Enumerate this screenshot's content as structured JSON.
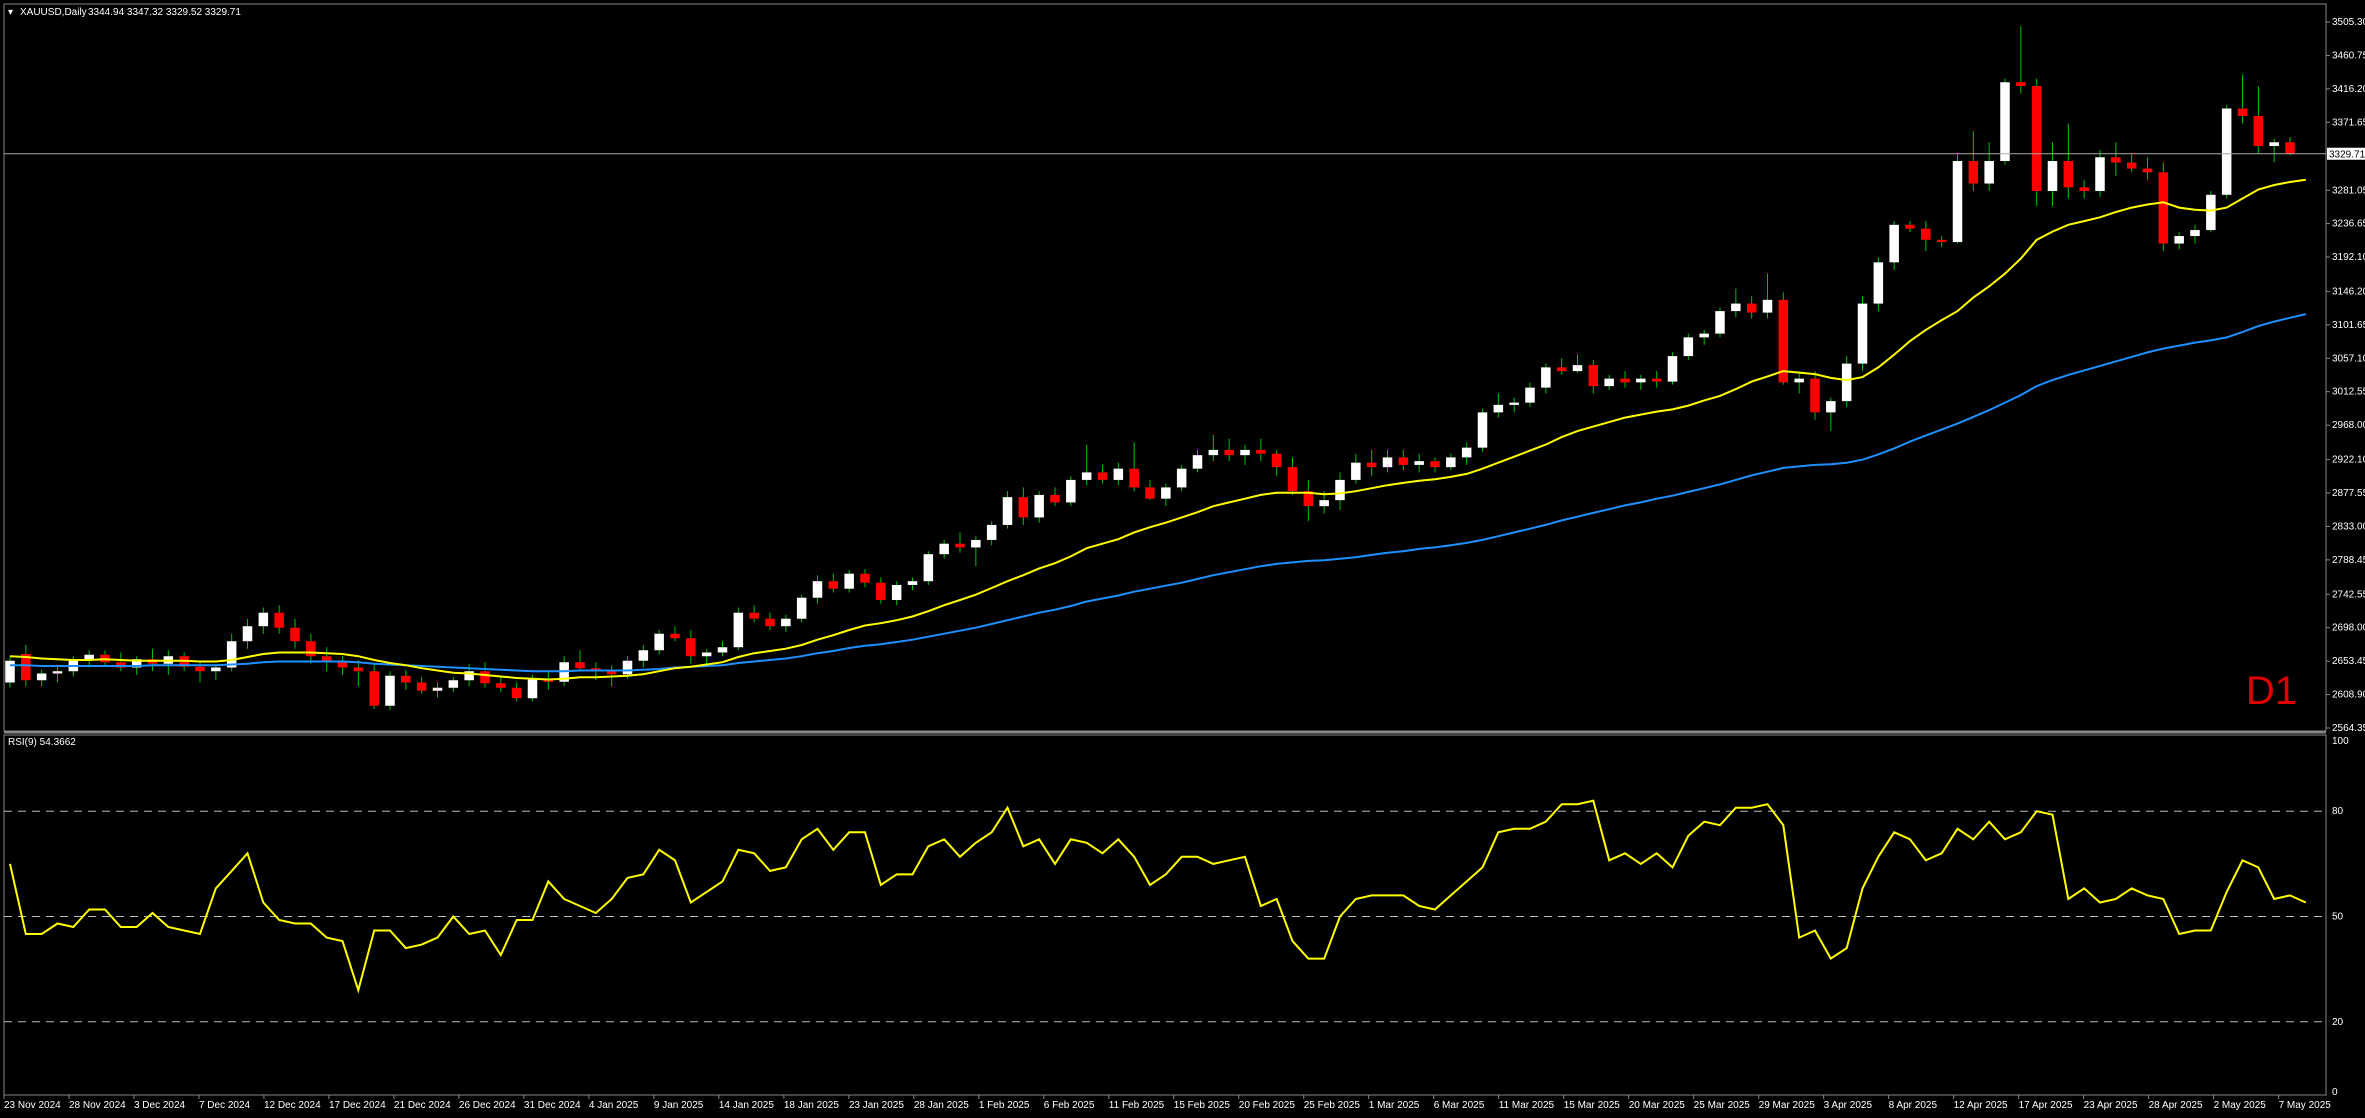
{
  "header": {
    "symbol": "XAUUSD,Daily",
    "ohlc": "3344.94 3347.32 3329.52 3329.71"
  },
  "timeframe_label": "D1",
  "price_axis": {
    "ticks": [
      "3505.30",
      "3460.75",
      "3416.20",
      "3371.65",
      "3281.05",
      "3236.65",
      "3192.10",
      "3146.20",
      "3101.65",
      "3057.10",
      "3012.55",
      "2968.00",
      "2922.10",
      "2877.55",
      "2833.00",
      "2788.45",
      "2742.55",
      "2698.00",
      "2653.45",
      "2608.90",
      "2564.35"
    ],
    "current_price": "3329.71",
    "ylim": [
      2564.35,
      3505.3
    ]
  },
  "rsi": {
    "label": "RSI(9) 54.3662",
    "levels": [
      80,
      50,
      20
    ],
    "ticks": [
      "100",
      "80",
      "50",
      "20",
      "0"
    ]
  },
  "date_labels": [
    "23 Nov 2024",
    "28 Nov 2024",
    "3 Dec 2024",
    "7 Dec 2024",
    "12 Dec 2024",
    "17 Dec 2024",
    "21 Dec 2024",
    "26 Dec 2024",
    "31 Dec 2024",
    "4 Jan 2025",
    "9 Jan 2025",
    "14 Jan 2025",
    "18 Jan 2025",
    "23 Jan 2025",
    "28 Jan 2025",
    "1 Feb 2025",
    "6 Feb 2025",
    "11 Feb 2025",
    "15 Feb 2025",
    "20 Feb 2025",
    "25 Feb 2025",
    "1 Mar 2025",
    "6 Mar 2025",
    "11 Mar 2025",
    "15 Mar 2025",
    "20 Mar 2025",
    "25 Mar 2025",
    "29 Mar 2025",
    "3 Apr 2025",
    "8 Apr 2025",
    "12 Apr 2025",
    "17 Apr 2025",
    "23 Apr 2025",
    "28 Apr 2025",
    "2 May 2025",
    "7 May 2025"
  ],
  "colors": {
    "bull": "#ffffff",
    "bear": "#ff0000",
    "wick": "#00c000",
    "ma_fast": "#ffff00",
    "ma_slow": "#1e90ff",
    "rsi_line": "#ffff00",
    "grid": "#bbbbbb"
  },
  "chart_data": {
    "type": "candlestick",
    "ylim": [
      2564.35,
      3505.3
    ],
    "candles": [
      [
        2625,
        2660,
        2618,
        2654
      ],
      [
        2663,
        2675,
        2620,
        2628
      ],
      [
        2628,
        2642,
        2620,
        2637
      ],
      [
        2637,
        2648,
        2625,
        2640
      ],
      [
        2640,
        2660,
        2633,
        2656
      ],
      [
        2656,
        2668,
        2645,
        2662
      ],
      [
        2662,
        2668,
        2648,
        2652
      ],
      [
        2652,
        2665,
        2640,
        2645
      ],
      [
        2645,
        2660,
        2635,
        2656
      ],
      [
        2656,
        2670,
        2640,
        2650
      ],
      [
        2650,
        2668,
        2635,
        2660
      ],
      [
        2660,
        2665,
        2640,
        2646
      ],
      [
        2646,
        2652,
        2625,
        2640
      ],
      [
        2640,
        2650,
        2628,
        2645
      ],
      [
        2645,
        2690,
        2640,
        2680
      ],
      [
        2680,
        2710,
        2670,
        2700
      ],
      [
        2700,
        2725,
        2690,
        2718
      ],
      [
        2718,
        2728,
        2690,
        2698
      ],
      [
        2698,
        2710,
        2670,
        2680
      ],
      [
        2680,
        2690,
        2650,
        2660
      ],
      [
        2660,
        2672,
        2640,
        2652
      ],
      [
        2652,
        2660,
        2635,
        2645
      ],
      [
        2645,
        2655,
        2620,
        2640
      ],
      [
        2640,
        2650,
        2590,
        2594
      ],
      [
        2594,
        2640,
        2588,
        2634
      ],
      [
        2634,
        2642,
        2615,
        2625
      ],
      [
        2625,
        2632,
        2610,
        2614
      ],
      [
        2614,
        2625,
        2605,
        2618
      ],
      [
        2618,
        2632,
        2612,
        2628
      ],
      [
        2628,
        2650,
        2620,
        2640
      ],
      [
        2640,
        2652,
        2618,
        2624
      ],
      [
        2624,
        2632,
        2612,
        2618
      ],
      [
        2618,
        2625,
        2600,
        2604
      ],
      [
        2604,
        2635,
        2600,
        2630
      ],
      [
        2630,
        2640,
        2615,
        2626
      ],
      [
        2626,
        2660,
        2620,
        2652
      ],
      [
        2652,
        2668,
        2640,
        2644
      ],
      [
        2644,
        2652,
        2628,
        2640
      ],
      [
        2640,
        2648,
        2620,
        2636
      ],
      [
        2636,
        2660,
        2630,
        2654
      ],
      [
        2654,
        2675,
        2645,
        2668
      ],
      [
        2668,
        2695,
        2662,
        2690
      ],
      [
        2690,
        2700,
        2680,
        2684
      ],
      [
        2684,
        2695,
        2650,
        2660
      ],
      [
        2660,
        2670,
        2650,
        2665
      ],
      [
        2665,
        2680,
        2660,
        2672
      ],
      [
        2672,
        2725,
        2668,
        2718
      ],
      [
        2718,
        2728,
        2705,
        2710
      ],
      [
        2710,
        2718,
        2695,
        2700
      ],
      [
        2700,
        2715,
        2692,
        2710
      ],
      [
        2710,
        2742,
        2705,
        2738
      ],
      [
        2738,
        2768,
        2730,
        2760
      ],
      [
        2760,
        2770,
        2745,
        2750
      ],
      [
        2750,
        2775,
        2745,
        2770
      ],
      [
        2770,
        2776,
        2752,
        2758
      ],
      [
        2758,
        2765,
        2730,
        2735
      ],
      [
        2735,
        2760,
        2728,
        2755
      ],
      [
        2755,
        2765,
        2748,
        2760
      ],
      [
        2760,
        2800,
        2755,
        2796
      ],
      [
        2796,
        2815,
        2790,
        2810
      ],
      [
        2810,
        2825,
        2798,
        2805
      ],
      [
        2805,
        2820,
        2780,
        2815
      ],
      [
        2815,
        2840,
        2808,
        2835
      ],
      [
        2835,
        2880,
        2830,
        2872
      ],
      [
        2872,
        2885,
        2835,
        2845
      ],
      [
        2845,
        2880,
        2838,
        2875
      ],
      [
        2875,
        2885,
        2860,
        2865
      ],
      [
        2865,
        2900,
        2860,
        2895
      ],
      [
        2895,
        2942,
        2888,
        2905
      ],
      [
        2905,
        2915,
        2890,
        2895
      ],
      [
        2895,
        2918,
        2888,
        2910
      ],
      [
        2910,
        2945,
        2880,
        2885
      ],
      [
        2885,
        2895,
        2868,
        2870
      ],
      [
        2870,
        2890,
        2860,
        2885
      ],
      [
        2885,
        2915,
        2880,
        2910
      ],
      [
        2910,
        2935,
        2905,
        2928
      ],
      [
        2928,
        2955,
        2920,
        2935
      ],
      [
        2935,
        2950,
        2920,
        2928
      ],
      [
        2928,
        2942,
        2915,
        2935
      ],
      [
        2935,
        2950,
        2920,
        2930
      ],
      [
        2930,
        2935,
        2900,
        2912
      ],
      [
        2912,
        2925,
        2875,
        2880
      ],
      [
        2880,
        2895,
        2840,
        2860
      ],
      [
        2860,
        2880,
        2850,
        2868
      ],
      [
        2868,
        2905,
        2855,
        2895
      ],
      [
        2895,
        2930,
        2890,
        2918
      ],
      [
        2918,
        2935,
        2900,
        2912
      ],
      [
        2912,
        2935,
        2905,
        2925
      ],
      [
        2925,
        2935,
        2908,
        2915
      ],
      [
        2915,
        2930,
        2905,
        2920
      ],
      [
        2920,
        2925,
        2905,
        2912
      ],
      [
        2912,
        2930,
        2908,
        2925
      ],
      [
        2925,
        2945,
        2915,
        2938
      ],
      [
        2938,
        2990,
        2932,
        2985
      ],
      [
        2985,
        3010,
        2978,
        2995
      ],
      [
        2995,
        3005,
        2985,
        2998
      ],
      [
        2998,
        3025,
        2992,
        3018
      ],
      [
        3018,
        3050,
        3010,
        3045
      ],
      [
        3045,
        3057,
        3035,
        3040
      ],
      [
        3040,
        3062,
        3038,
        3048
      ],
      [
        3048,
        3055,
        3010,
        3020
      ],
      [
        3020,
        3035,
        3015,
        3030
      ],
      [
        3030,
        3040,
        3018,
        3025
      ],
      [
        3025,
        3035,
        3015,
        3030
      ],
      [
        3030,
        3040,
        3018,
        3026
      ],
      [
        3026,
        3065,
        3022,
        3060
      ],
      [
        3060,
        3090,
        3055,
        3085
      ],
      [
        3085,
        3095,
        3075,
        3090
      ],
      [
        3090,
        3125,
        3085,
        3120
      ],
      [
        3120,
        3150,
        3112,
        3130
      ],
      [
        3130,
        3140,
        3110,
        3118
      ],
      [
        3118,
        3170,
        3110,
        3135
      ],
      [
        3135,
        3145,
        3022,
        3025
      ],
      [
        3025,
        3040,
        3010,
        3030
      ],
      [
        3030,
        3040,
        2975,
        2985
      ],
      [
        2985,
        3005,
        2960,
        3000
      ],
      [
        3000,
        3060,
        2992,
        3050
      ],
      [
        3050,
        3140,
        3040,
        3130
      ],
      [
        3130,
        3192,
        3120,
        3185
      ],
      [
        3185,
        3240,
        3175,
        3235
      ],
      [
        3235,
        3240,
        3225,
        3230
      ],
      [
        3230,
        3240,
        3200,
        3215
      ],
      [
        3215,
        3220,
        3205,
        3212
      ],
      [
        3212,
        3330,
        3210,
        3320
      ],
      [
        3320,
        3360,
        3280,
        3290
      ],
      [
        3290,
        3345,
        3280,
        3320
      ],
      [
        3320,
        3430,
        3315,
        3425
      ],
      [
        3425,
        3500,
        3410,
        3420
      ],
      [
        3420,
        3430,
        3260,
        3280
      ],
      [
        3280,
        3345,
        3260,
        3320
      ],
      [
        3320,
        3370,
        3270,
        3285
      ],
      [
        3285,
        3295,
        3270,
        3280
      ],
      [
        3280,
        3335,
        3272,
        3325
      ],
      [
        3325,
        3345,
        3300,
        3318
      ],
      [
        3318,
        3330,
        3305,
        3310
      ],
      [
        3310,
        3325,
        3295,
        3305
      ],
      [
        3305,
        3318,
        3200,
        3210
      ],
      [
        3210,
        3225,
        3202,
        3220
      ],
      [
        3220,
        3235,
        3210,
        3228
      ],
      [
        3228,
        3280,
        3225,
        3275
      ],
      [
        3275,
        3395,
        3270,
        3390
      ],
      [
        3390,
        3435,
        3370,
        3380
      ],
      [
        3380,
        3420,
        3330,
        3340
      ],
      [
        3340,
        3350,
        3318,
        3345
      ],
      [
        3345,
        3352,
        3328,
        3330
      ]
    ],
    "rsi_values": [
      65,
      45,
      45,
      48,
      47,
      52,
      52,
      47,
      47,
      51,
      47,
      46,
      45,
      58,
      63,
      68,
      54,
      49,
      48,
      48,
      44,
      43,
      29,
      46,
      46,
      41,
      42,
      44,
      50,
      45,
      46,
      39,
      49,
      49,
      60,
      55,
      53,
      51,
      55,
      61,
      62,
      69,
      66,
      54,
      57,
      60,
      69,
      68,
      63,
      64,
      72,
      75,
      69,
      74,
      74,
      59,
      62,
      62,
      70,
      72,
      67,
      71,
      74,
      81,
      70,
      72,
      65,
      72,
      71,
      68,
      72,
      67,
      59,
      62,
      67,
      67,
      65,
      66,
      67,
      53,
      55,
      43,
      38,
      38,
      50,
      55,
      56,
      56,
      56,
      53,
      52,
      56,
      60,
      64,
      74,
      75,
      75,
      77,
      82,
      82,
      83,
      66,
      68,
      65,
      68,
      64,
      73,
      77,
      76,
      81,
      81,
      82,
      76,
      44,
      46,
      38,
      41,
      58,
      67,
      74,
      72,
      66,
      68,
      75,
      72,
      77,
      72,
      74,
      80,
      79,
      55,
      58,
      54,
      55,
      58,
      56,
      55,
      45,
      46,
      46,
      57,
      66,
      64,
      55,
      56,
      54
    ],
    "ma_fast": [
      2660,
      2659,
      2657,
      2656,
      2655,
      2655,
      2656,
      2655,
      2654,
      2654,
      2654,
      2654,
      2653,
      2653,
      2655,
      2659,
      2663,
      2665,
      2665,
      2665,
      2664,
      2663,
      2660,
      2655,
      2651,
      2648,
      2644,
      2641,
      2638,
      2637,
      2635,
      2633,
      2631,
      2630,
      2629,
      2630,
      2632,
      2632,
      2633,
      2634,
      2636,
      2640,
      2644,
      2646,
      2649,
      2652,
      2659,
      2664,
      2667,
      2670,
      2675,
      2682,
      2688,
      2695,
      2701,
      2704,
      2708,
      2713,
      2720,
      2728,
      2735,
      2742,
      2751,
      2760,
      2768,
      2777,
      2784,
      2793,
      2804,
      2810,
      2816,
      2825,
      2832,
      2838,
      2845,
      2852,
      2860,
      2865,
      2870,
      2875,
      2878,
      2878,
      2878,
      2876,
      2877,
      2880,
      2884,
      2888,
      2891,
      2894,
      2896,
      2899,
      2903,
      2910,
      2918,
      2926,
      2934,
      2942,
      2952,
      2960,
      2966,
      2972,
      2978,
      2982,
      2986,
      2989,
      2994,
      3001,
      3007,
      3016,
      3026,
      3033,
      3040,
      3038,
      3036,
      3031,
      3028,
      3032,
      3045,
      3062,
      3080,
      3095,
      3108,
      3120,
      3138,
      3153,
      3170,
      3190,
      3215,
      3226,
      3235,
      3240,
      3245,
      3252,
      3258,
      3262,
      3265,
      3258,
      3255,
      3254,
      3258,
      3270,
      3282,
      3288,
      3292,
      3295
    ],
    "ma_slow": [
      2648,
      2648,
      2647,
      2647,
      2647,
      2647,
      2647,
      2647,
      2647,
      2648,
      2648,
      2648,
      2648,
      2648,
      2649,
      2650,
      2652,
      2653,
      2653,
      2653,
      2653,
      2653,
      2652,
      2650,
      2649,
      2648,
      2647,
      2646,
      2645,
      2644,
      2643,
      2642,
      2641,
      2640,
      2640,
      2640,
      2641,
      2641,
      2641,
      2641,
      2642,
      2643,
      2645,
      2646,
      2647,
      2648,
      2651,
      2653,
      2655,
      2657,
      2660,
      2664,
      2667,
      2671,
      2674,
      2676,
      2679,
      2682,
      2686,
      2690,
      2694,
      2698,
      2703,
      2708,
      2713,
      2718,
      2722,
      2727,
      2733,
      2737,
      2741,
      2746,
      2750,
      2754,
      2758,
      2763,
      2768,
      2772,
      2776,
      2780,
      2783,
      2785,
      2787,
      2788,
      2790,
      2792,
      2795,
      2798,
      2800,
      2803,
      2805,
      2808,
      2811,
      2815,
      2820,
      2825,
      2830,
      2835,
      2841,
      2846,
      2851,
      2856,
      2861,
      2865,
      2870,
      2874,
      2879,
      2884,
      2889,
      2895,
      2901,
      2906,
      2911,
      2913,
      2915,
      2916,
      2918,
      2922,
      2929,
      2937,
      2946,
      2954,
      2962,
      2970,
      2979,
      2988,
      2998,
      3008,
      3020,
      3028,
      3035,
      3041,
      3047,
      3053,
      3059,
      3065,
      3070,
      3074,
      3078,
      3081,
      3085,
      3092,
      3100,
      3106,
      3111,
      3116
    ]
  }
}
